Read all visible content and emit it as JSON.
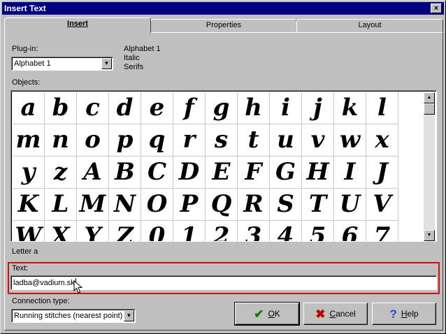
{
  "window": {
    "title": "Insert Text",
    "close_glyph": "×"
  },
  "tabs": [
    {
      "label": "Insert",
      "active": true
    },
    {
      "label": "Properties",
      "active": false
    },
    {
      "label": "Layout",
      "active": false
    }
  ],
  "plugin": {
    "label": "Plug-in:",
    "value": "Alphabet 1",
    "info": [
      "Alphabet 1",
      "Italic",
      "Serifs"
    ]
  },
  "objects": {
    "label": "Objects:",
    "glyphs": [
      "a",
      "b",
      "c",
      "d",
      "e",
      "f",
      "g",
      "h",
      "i",
      "j",
      "k",
      "l",
      "m",
      "n",
      "o",
      "p",
      "q",
      "r",
      "s",
      "t",
      "u",
      "v",
      "w",
      "x",
      "y",
      "z",
      "A",
      "B",
      "C",
      "D",
      "E",
      "F",
      "G",
      "H",
      "I",
      "J",
      "K",
      "L",
      "M",
      "N",
      "O",
      "P",
      "Q",
      "R",
      "S",
      "T",
      "U",
      "V",
      "W",
      "X",
      "Y",
      "Z",
      "0",
      "1",
      "2",
      "3",
      "4",
      "5",
      "6",
      "7"
    ]
  },
  "status": {
    "selected_label": "Letter a"
  },
  "text_field": {
    "label": "Text:",
    "value": "ladba@vadium.sk"
  },
  "connection": {
    "label": "Connection type:",
    "value": "Running stitches (nearest point)"
  },
  "buttons": {
    "ok": {
      "label": "OK",
      "icon": "checkmark-icon",
      "color": "#008000"
    },
    "cancel": {
      "label": "Cancel",
      "icon": "x-icon",
      "color": "#c00000"
    },
    "help": {
      "label": "Help",
      "icon": "question-icon",
      "color": "#2050c0"
    }
  },
  "colors": {
    "titlebar": "#000080",
    "highlight_border": "#d01010",
    "face": "#c0c0c0"
  }
}
